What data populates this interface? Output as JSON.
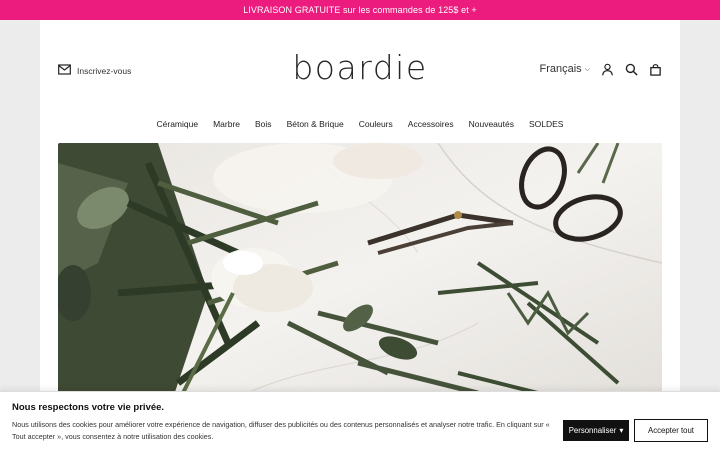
{
  "announcement": "LIVRAISON GRATUITE sur les commandes de 125$ et +",
  "header": {
    "signup_label": "Inscrivez-vous",
    "logo": "boardie",
    "language": "Français"
  },
  "nav": {
    "items": [
      "Céramique",
      "Marbre",
      "Bois",
      "Béton & Brique",
      "Couleurs",
      "Accessoires",
      "Nouveautés",
      "SOLDES"
    ]
  },
  "cookie": {
    "title": "Nous respectons votre vie privée.",
    "text": "Nous utilisons des cookies pour améliorer votre expérience de navigation, diffuser des publicités ou des contenus personnalisés et analyser notre trafic. En cliquant sur « Tout accepter », vous consentez à notre utilisation des cookies.",
    "customize_label": "Personnaliser",
    "accept_label": "Accepter tout"
  },
  "colors": {
    "announcement_bg": "#ec1c7e",
    "page_bg": "#ffffff",
    "button_dark": "#111111"
  }
}
